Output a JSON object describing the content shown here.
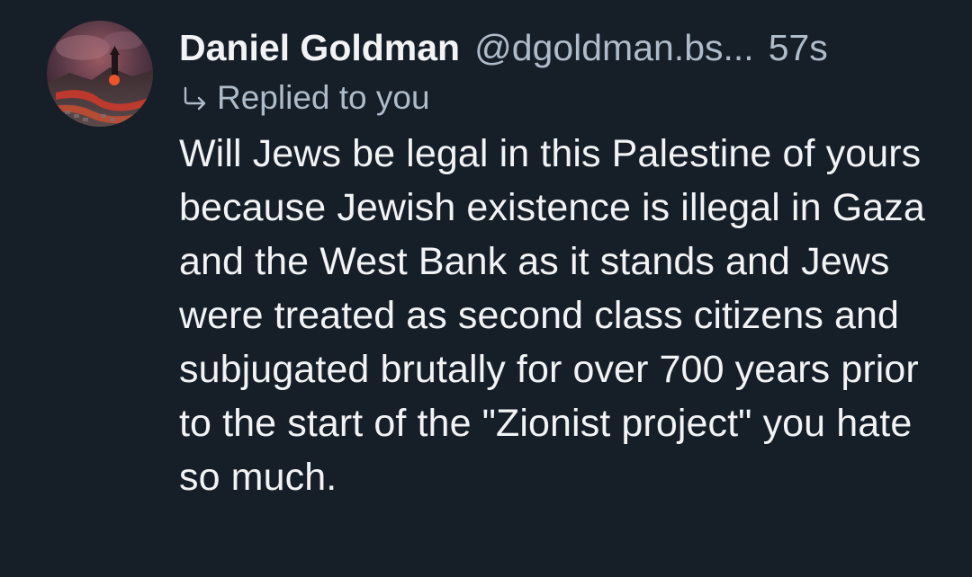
{
  "post": {
    "author": {
      "display_name": "Daniel Goldman",
      "handle": "@dgoldman.bs...",
      "avatar_icon": "avatar-image"
    },
    "timestamp": "57s",
    "reply_label": "Replied to you",
    "reply_icon": "reply-arrow-icon",
    "body": "Will Jews be legal in this Palestine of yours because Jewish existence is illegal in Gaza and the West Bank as it stands and Jews were treated as second class citizens and subjugated brutally for over 700 years prior to the start of the \"Zionist project\" you hate so much."
  },
  "colors": {
    "background": "#161e27",
    "primary_text": "#f1f3f5",
    "secondary_text": "#aebbc9"
  }
}
